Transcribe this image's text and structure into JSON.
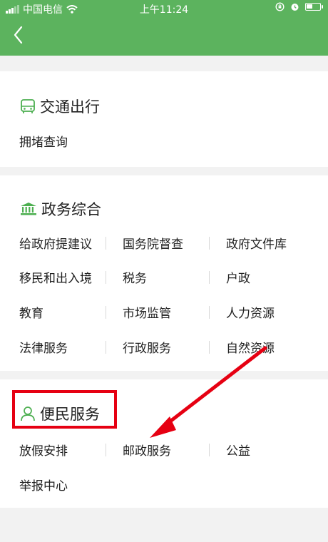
{
  "status_bar": {
    "carrier": "中国电信",
    "time": "上午11:24",
    "battery_level": 0.45
  },
  "sections": [
    {
      "title": "交通出行",
      "icon": "bus-icon",
      "items": [
        "拥堵查询"
      ]
    },
    {
      "title": "政务综合",
      "icon": "government-building-icon",
      "items": [
        "给政府提建议",
        "国务院督查",
        "政府文件库",
        "移民和出入境",
        "税务",
        "户政",
        "教育",
        "市场监管",
        "人力资源",
        "法律服务",
        "行政服务",
        "自然资源"
      ]
    },
    {
      "title": "便民服务",
      "icon": "person-icon",
      "items": [
        "放假安排",
        "邮政服务",
        "公益",
        "举报中心"
      ]
    }
  ],
  "colors": {
    "header_green": "#5cb35e",
    "icon_green": "#4caf50",
    "highlight_red": "#e60012"
  }
}
